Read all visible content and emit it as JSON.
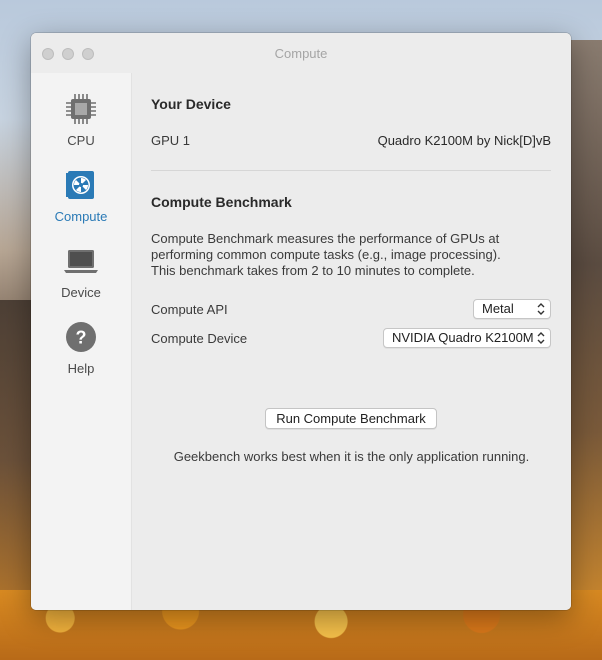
{
  "window": {
    "title": "Compute"
  },
  "sidebar": {
    "items": [
      {
        "label": "CPU",
        "icon": "cpu-chip-icon",
        "active": false
      },
      {
        "label": "Compute",
        "icon": "gpu-card-icon",
        "active": true
      },
      {
        "label": "Device",
        "icon": "laptop-icon",
        "active": false
      },
      {
        "label": "Help",
        "icon": "help-question-icon",
        "active": false
      }
    ]
  },
  "device": {
    "heading": "Your Device",
    "gpu_label": "GPU 1",
    "gpu_value": "Quadro K2100M by Nick[D]vB"
  },
  "benchmark": {
    "heading": "Compute Benchmark",
    "description": "Compute Benchmark measures the performance of GPUs at performing common compute tasks (e.g., image processing). This benchmark takes from 2 to 10 minutes to complete.",
    "api_label": "Compute API",
    "api_value": "Metal",
    "device_label": "Compute Device",
    "device_value": "NVIDIA Quadro K2100M",
    "run_button": "Run Compute Benchmark",
    "note": "Geekbench works best when it is the only application running."
  },
  "colors": {
    "accent": "#2a7ab6",
    "window_bg": "#ececec",
    "sidebar_bg": "#f3f3f3"
  }
}
